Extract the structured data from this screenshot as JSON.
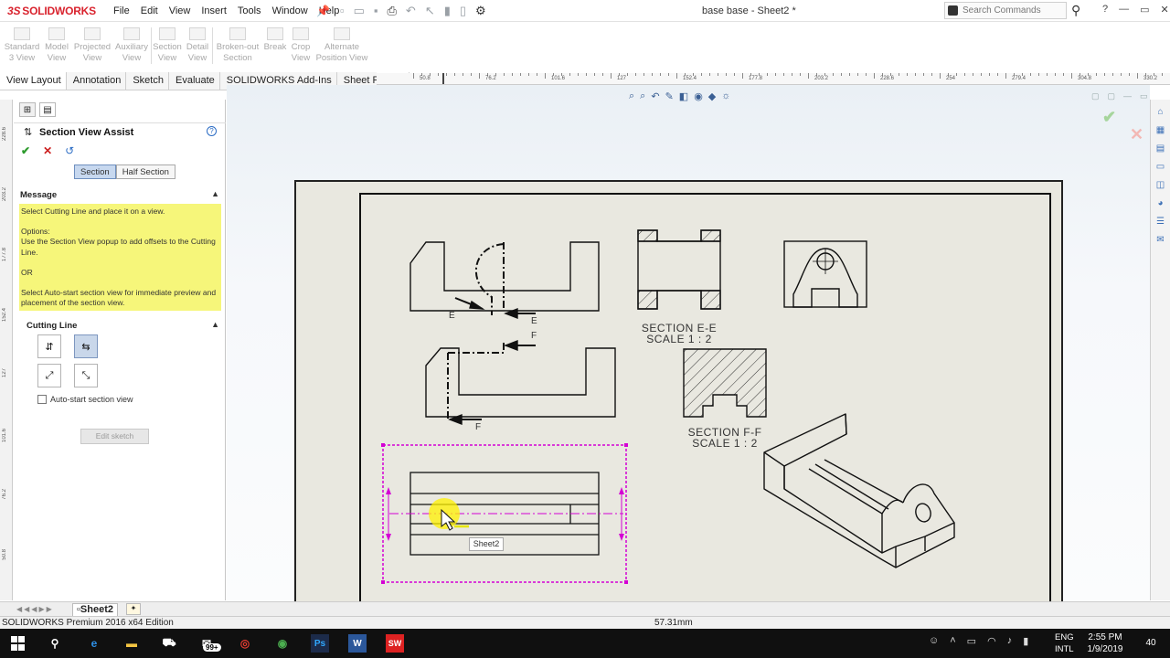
{
  "app": {
    "logo_text": "SOLIDWORKS",
    "logo_prefix": "3S",
    "document_title": "base base - Sheet2 *",
    "menus": [
      "File",
      "Edit",
      "View",
      "Insert",
      "Tools",
      "Window",
      "Help"
    ],
    "search_placeholder": "Search Commands"
  },
  "ribbon": [
    {
      "label": "Standard 3 View"
    },
    {
      "label": "Model View"
    },
    {
      "label": "Projected View"
    },
    {
      "label": "Auxiliary View"
    },
    {
      "label": "Section View"
    },
    {
      "label": "Detail View"
    },
    {
      "label": "Broken-out Section"
    },
    {
      "label": "Break"
    },
    {
      "label": "Crop View"
    },
    {
      "label": "Alternate Position View"
    }
  ],
  "tabs": [
    "View Layout",
    "Annotation",
    "Sketch",
    "Evaluate",
    "SOLIDWORKS Add-Ins",
    "Sheet Format"
  ],
  "ruler_labels": [
    "50.8",
    "76.2",
    "101.6",
    "127",
    "152.4",
    "177.8",
    "203.2",
    "228.6",
    "254",
    "279.4",
    "304.8",
    "330.2"
  ],
  "vruler_labels": [
    "228.6",
    "203.2",
    "177.8",
    "152.4",
    "127",
    "101.6",
    "76.2",
    "50.8"
  ],
  "property_manager": {
    "title": "Section View Assist",
    "segments": [
      "Section",
      "Half Section"
    ],
    "active_segment": "Section",
    "message_header": "Message",
    "message_lines": [
      "Select Cutting Line and place it on a view.",
      "Options:\nUse the Section View popup to add offsets to the Cutting Line.",
      "OR",
      "Select Auto-start section view for immediate preview and placement of the section view."
    ],
    "cutting_line_header": "Cutting Line",
    "auto_start_label": "Auto-start section view",
    "edit_sketch_label": "Edit sketch"
  },
  "drawing": {
    "section_ee_label": "SECTION E-E",
    "section_ee_scale": "SCALE 1 : 2",
    "section_ff_label": "SECTION F-F",
    "section_ff_scale": "SCALE 1 : 2",
    "cut_letters": [
      "E",
      "E",
      "F",
      "F"
    ],
    "tooltip": "Sheet2"
  },
  "sheet_tab": "Sheet2",
  "status": {
    "edition": "SOLIDWORKS Premium 2016 x64 Edition",
    "measurement": "57.31mm"
  },
  "taskbar": {
    "lang_top": "ENG",
    "lang_bottom": "INTL",
    "time": "2:55 PM",
    "date": "1/9/2019",
    "notifications": "40",
    "mail_badge": "99+"
  }
}
